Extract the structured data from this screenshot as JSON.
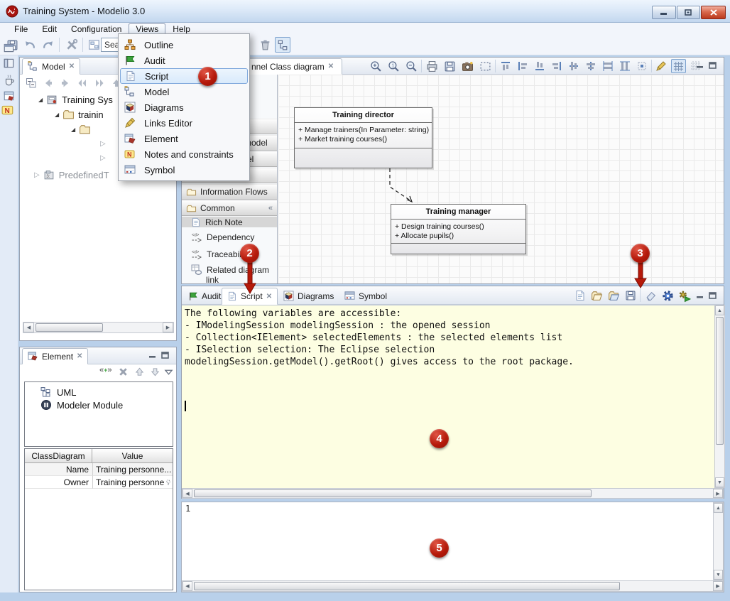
{
  "window": {
    "title": "Training System - Modelio 3.0"
  },
  "menubar": {
    "file": "File",
    "edit": "Edit",
    "configuration": "Configuration",
    "views": "Views",
    "help": "Help"
  },
  "toolbar": {
    "search_value": "Sea"
  },
  "views_menu": {
    "outline": "Outline",
    "audit": "Audit",
    "script": "Script",
    "model": "Model",
    "diagrams": "Diagrams",
    "links_editor": "Links Editor",
    "element": "Element",
    "notes": "Notes and constraints",
    "symbol": "Symbol"
  },
  "model_panel": {
    "tab_label": "Model",
    "tree": {
      "item1": "Training Sys",
      "item2": "trainin",
      "item6": "PredefinedT"
    }
  },
  "palette": {
    "group2": "model",
    "group3": "el",
    "group5": "Information Flows",
    "group6": "Common",
    "item_rich_note": "Rich Note",
    "item_dependency": "Dependency",
    "item_traceability": "Traceability",
    "item_related_1": "Related diagram",
    "item_related_2": "link"
  },
  "diagram": {
    "tab_label": "nnel Class diagram",
    "director": {
      "name": "Training director",
      "op1": "+ Manage trainers(In Parameter: string)",
      "op2": "+ Market training courses()"
    },
    "manager": {
      "name": "Training manager",
      "op1": "+ Design training courses()",
      "op2": "+ Allocate pupils()"
    }
  },
  "script_panel": {
    "tab_audit": "Audit",
    "tab_script": "Script",
    "tab_diagrams": "Diagrams",
    "tab_symbol": "Symbol",
    "line1": "The following variables are accessible:",
    "line2": "- IModelingSession modelingSession : the opened session",
    "line3": "- Collection<IElement> selectedElements : the selected elements list",
    "line4": "- ISelection selection: The Eclipse selection",
    "line5": "modelingSession.getModel().getRoot() gives access to the root package."
  },
  "element_panel": {
    "tab_label": "Element",
    "item1": "UML",
    "item2": "Modeler Module",
    "table": {
      "col1": "ClassDiagram",
      "col2": "Value",
      "row1_label": "Name",
      "row1_value": "Training personne...",
      "row2_label": "Owner",
      "row2_value": "Training personne"
    }
  },
  "input_panel": {
    "line_number": "1"
  },
  "badges": {
    "b1": "1",
    "b2": "2",
    "b3": "3",
    "b4": "4",
    "b5": "5"
  }
}
